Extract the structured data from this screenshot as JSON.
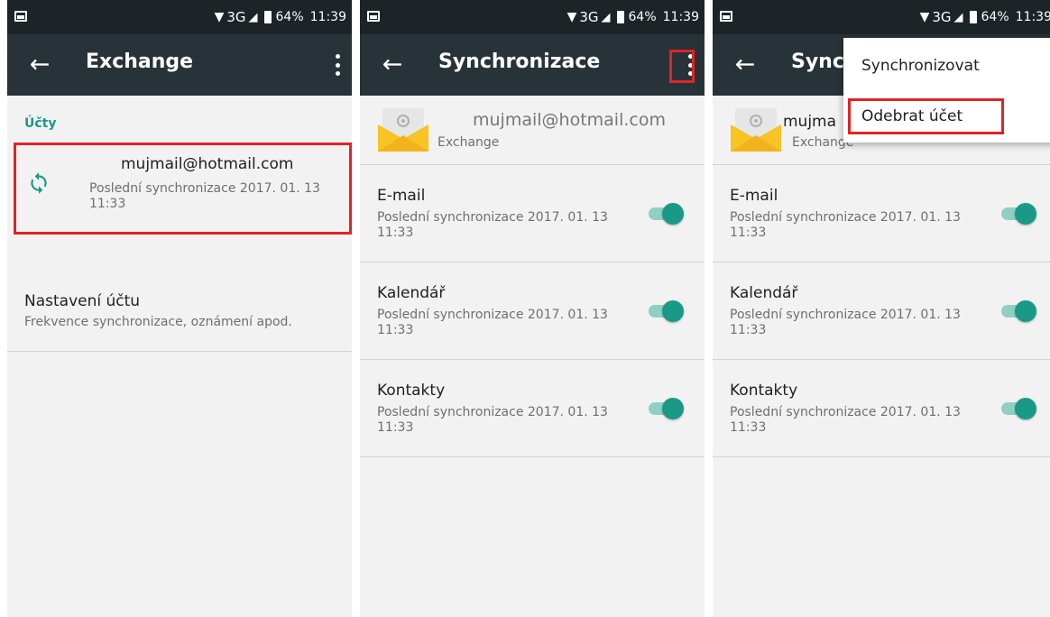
{
  "status_bar": {
    "network": "3G",
    "battery": "64%",
    "time": "11:39"
  },
  "panel1": {
    "title": "Exchange",
    "section_header": "Účty",
    "account": {
      "email": "mujmail@hotmail.com",
      "last_sync": "Poslední synchronizace 2017. 01. 13 11:33"
    },
    "settings": {
      "title": "Nastavení účtu",
      "subtitle": "Frekvence synchronizace, oznámení apod."
    }
  },
  "panel2": {
    "title": "Synchronizace",
    "account_email": "mujmail@hotmail.com",
    "account_type": "Exchange",
    "items": [
      {
        "title": "E-mail",
        "subtitle": "Poslední synchronizace 2017. 01. 13 11:33",
        "enabled": true
      },
      {
        "title": "Kalendář",
        "subtitle": "Poslední synchronizace 2017. 01. 13 11:33",
        "enabled": true
      },
      {
        "title": "Kontakty",
        "subtitle": "Poslední synchronizace 2017. 01. 13 11:33",
        "enabled": true
      }
    ]
  },
  "panel3": {
    "title": "Synch",
    "account_email": "mujma",
    "account_type": "Exchange",
    "menu": [
      {
        "label": "Synchronizovat"
      },
      {
        "label": "Odebrat účet"
      }
    ],
    "items": [
      {
        "title": "E-mail",
        "subtitle": "Poslední synchronizace 2017. 01. 13 11:33",
        "enabled": true
      },
      {
        "title": "Kalendář",
        "subtitle": "Poslední synchronizace 2017. 01. 13 11:33",
        "enabled": true
      },
      {
        "title": "Kontakty",
        "subtitle": "Poslední synchronizace 2017. 01. 13 11:33",
        "enabled": true
      }
    ]
  },
  "colors": {
    "accent": "#1a9a86",
    "app_bar": "#273339",
    "status_bar": "#1c2428",
    "highlight": "#e02424",
    "background": "#f2f2f2"
  }
}
